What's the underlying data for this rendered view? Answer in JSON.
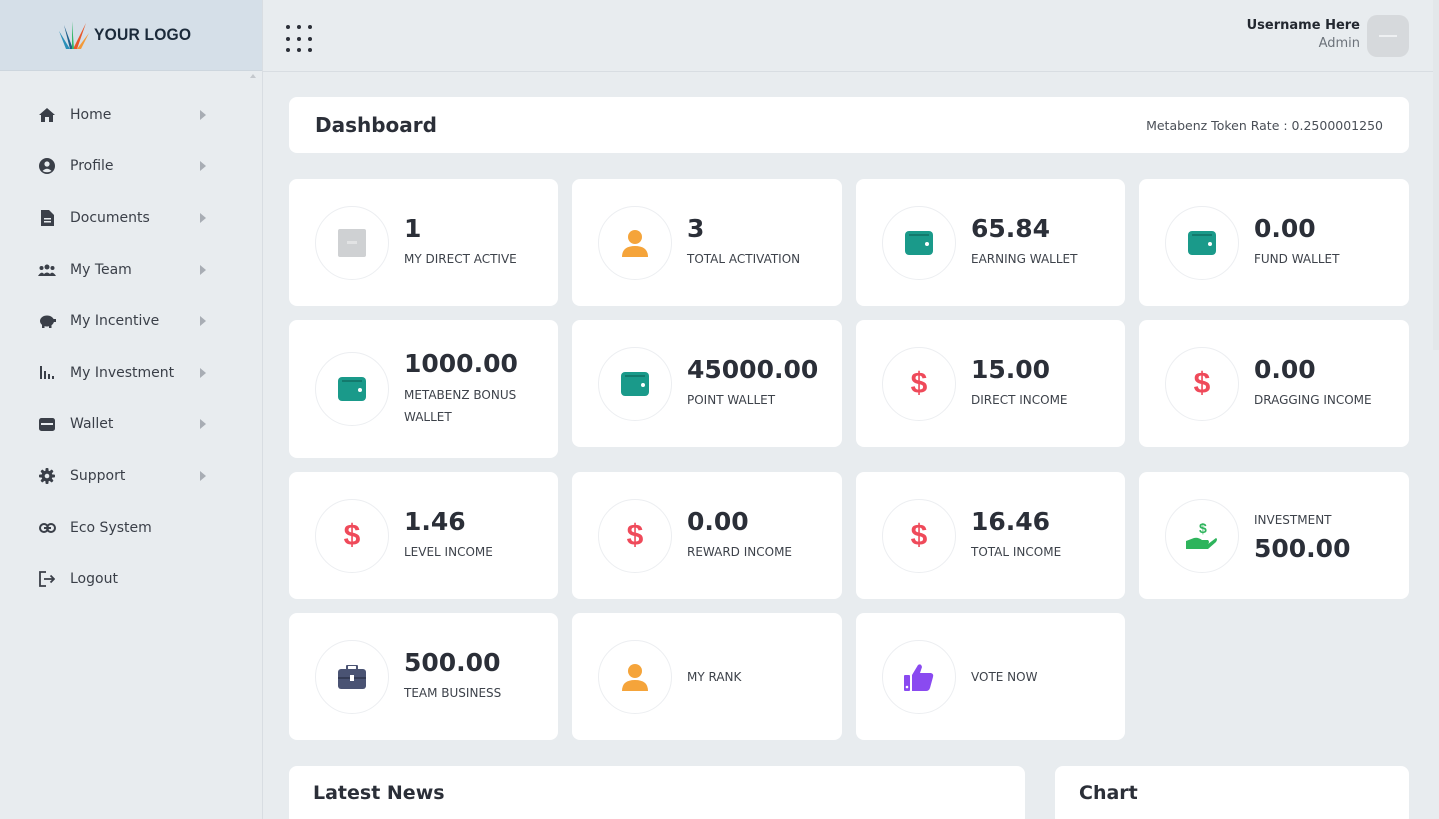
{
  "logo": {
    "text": "YOUR LOGO"
  },
  "sidebar": {
    "items": [
      {
        "label": "Home",
        "icon": "home-icon",
        "arrow": true
      },
      {
        "label": "Profile",
        "icon": "user-circle-icon",
        "arrow": true
      },
      {
        "label": "Documents",
        "icon": "document-icon",
        "arrow": true
      },
      {
        "label": "My Team",
        "icon": "team-icon",
        "arrow": true
      },
      {
        "label": "My Incentive",
        "icon": "piggy-bank-icon",
        "arrow": true
      },
      {
        "label": "My Investment",
        "icon": "bar-chart-icon",
        "arrow": true
      },
      {
        "label": "Wallet",
        "icon": "wallet-icon",
        "arrow": true
      },
      {
        "label": "Support",
        "icon": "gear-icon",
        "arrow": true
      },
      {
        "label": "Eco System",
        "icon": "link-icon",
        "arrow": false
      },
      {
        "label": "Logout",
        "icon": "logout-icon",
        "arrow": false
      }
    ]
  },
  "topbar": {
    "username": "Username Here",
    "role": "Admin"
  },
  "header": {
    "title": "Dashboard",
    "token_rate": "Metabenz Token Rate : 0.2500001250"
  },
  "cards": [
    {
      "value": "1",
      "label": "MY DIRECT ACTIVE",
      "icon": "image-placeholder-icon"
    },
    {
      "value": "3",
      "label": "TOTAL ACTIVATION",
      "icon": "user-icon"
    },
    {
      "value": "65.84",
      "label": "EARNING WALLET",
      "icon": "wallet-icon"
    },
    {
      "value": "0.00",
      "label": "FUND WALLET",
      "icon": "wallet-icon"
    },
    {
      "value": "1000.00",
      "label": "METABENZ BONUS WALLET",
      "icon": "wallet-icon"
    },
    {
      "value": "45000.00",
      "label": "POINT WALLET",
      "icon": "wallet-icon"
    },
    {
      "value": "15.00",
      "label": "DIRECT INCOME",
      "icon": "dollar-icon"
    },
    {
      "value": "0.00",
      "label": "DRAGGING INCOME",
      "icon": "dollar-icon"
    },
    {
      "value": "1.46",
      "label": "LEVEL INCOME",
      "icon": "dollar-icon"
    },
    {
      "value": "0.00",
      "label": "REWARD INCOME",
      "icon": "dollar-icon"
    },
    {
      "value": "16.46",
      "label": "TOTAL INCOME",
      "icon": "dollar-icon"
    },
    {
      "value": "500.00",
      "label": "INVESTMENT",
      "icon": "hand-dollar-icon"
    },
    {
      "value": "500.00",
      "label": "TEAM BUSINESS",
      "icon": "briefcase-icon"
    },
    {
      "value": "",
      "label": "MY RANK",
      "icon": "user-icon"
    },
    {
      "value": "",
      "label": "VOTE NOW",
      "icon": "thumbs-up-icon"
    }
  ],
  "sections": {
    "news_title": "Latest News",
    "chart_title": "Chart"
  },
  "colors": {
    "teal": "#1a9a8a",
    "orange": "#f5a43a",
    "red": "#ef4a5a",
    "green": "#2eb45c",
    "purple": "#8a4af0",
    "navy": "#4a5373"
  }
}
